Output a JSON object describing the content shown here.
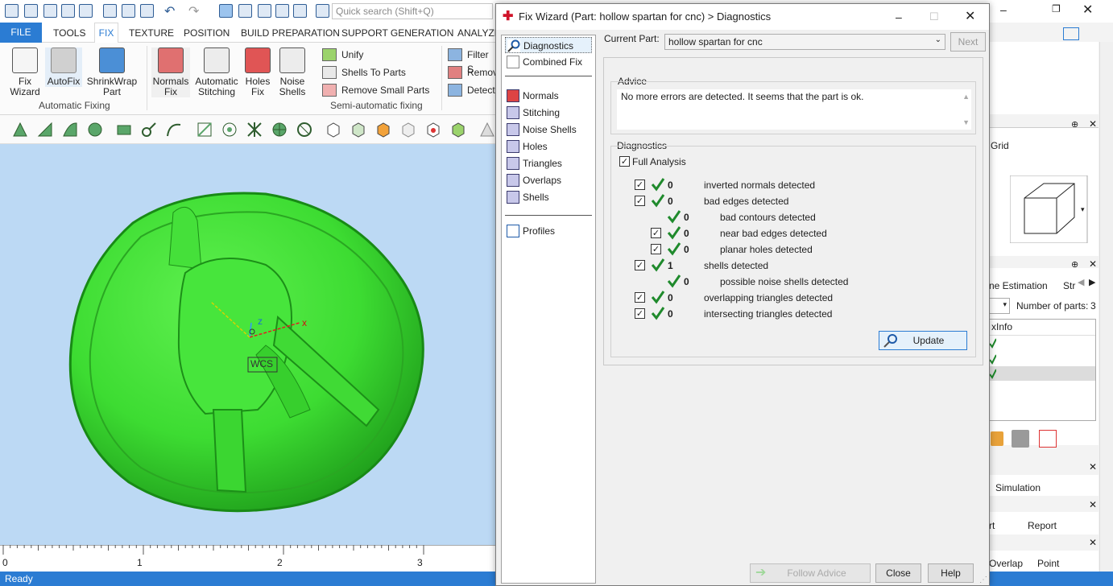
{
  "app": {
    "search_placeholder": "Quick search (Shift+Q)",
    "status": "Ready"
  },
  "tabs": [
    "FILE",
    "TOOLS",
    "FIX",
    "TEXTURE",
    "POSITION",
    "BUILD PREPARATION",
    "SUPPORT GENERATION",
    "ANALYZE"
  ],
  "ribbon": {
    "fix_wizard": "Fix\nWizard",
    "autofix": "AutoFix",
    "shrinkwrap": "ShrinkWrap\nPart",
    "normals_fix": "Normals\nFix",
    "auto_stitching": "Automatic\nStitching",
    "holes_fix": "Holes\nFix",
    "noise_shells": "Noise\nShells",
    "unify": "Unify",
    "shells_to_parts": "Shells To Parts",
    "remove_small_parts": "Remove Small Parts",
    "filter": "Filter S",
    "remove": "Remov",
    "detect": "Detect",
    "group_auto": "Automatic Fixing",
    "group_semi": "Semi-automatic fixing"
  },
  "viewport": {
    "axis_z": "z",
    "axis_x": "x",
    "wcs": "WCS",
    "ruler": [
      "0",
      "1",
      "2",
      "3"
    ]
  },
  "right_panel": {
    "grid": "Grid",
    "time_estimation": "ne Estimation",
    "str": "Str",
    "number_of_parts_label": "Number of parts:",
    "number_of_parts": "3",
    "info": "xInfo",
    "simulation": "Simulation",
    "rt": "rt",
    "report": "Report",
    "overlap": "Overlap",
    "point": "Point"
  },
  "dialog": {
    "title": "Fix Wizard (Part: hollow spartan  for cnc) > Diagnostics",
    "nav": [
      "Diagnostics",
      "Combined Fix",
      "Normals",
      "Stitching",
      "Noise Shells",
      "Holes",
      "Triangles",
      "Overlaps",
      "Shells",
      "Profiles"
    ],
    "current_part_label": "Current Part:",
    "current_part": "hollow spartan  for cnc",
    "next": "Next",
    "advice_label": "Advice",
    "advice_text": "No more errors are detected. It seems that the part is ok.",
    "diagnostics_label": "Diagnostics",
    "full_analysis": "Full Analysis",
    "rows": [
      {
        "count": "0",
        "text": "inverted normals detected",
        "indent": 0,
        "check": true
      },
      {
        "count": "0",
        "text": "bad edges detected",
        "indent": 0,
        "check": true
      },
      {
        "count": "0",
        "text": "bad contours detected",
        "indent": 2,
        "check": false
      },
      {
        "count": "0",
        "text": "near bad edges detected",
        "indent": 1,
        "check": true
      },
      {
        "count": "0",
        "text": "planar holes detected",
        "indent": 1,
        "check": true
      },
      {
        "count": "1",
        "text": "shells detected",
        "indent": 0,
        "check": true
      },
      {
        "count": "0",
        "text": "possible noise shells detected",
        "indent": 2,
        "check": false
      },
      {
        "count": "0",
        "text": "overlapping triangles detected",
        "indent": 0,
        "check": true
      },
      {
        "count": "0",
        "text": "intersecting triangles detected",
        "indent": 0,
        "check": true
      }
    ],
    "update": "Update",
    "follow_advice": "Follow Advice",
    "close": "Close",
    "help": "Help"
  },
  "colors": {
    "accent": "#2b7cd3",
    "part": "#3ddc32",
    "viewport": "#bcd9f4",
    "check": "#1f8a2c"
  }
}
